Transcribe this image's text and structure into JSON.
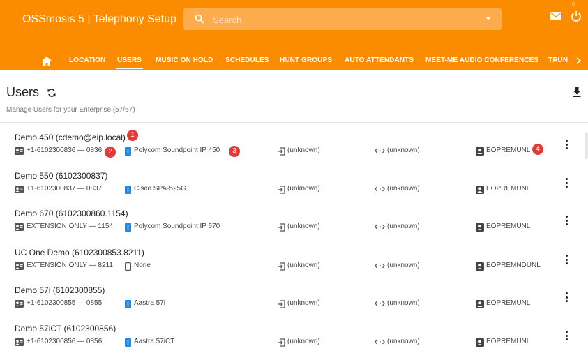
{
  "app": {
    "title": "OSSmosis 5 | Telephony Setup",
    "search_placeholder": "Search",
    "notification_count": "0"
  },
  "nav": {
    "tabs": [
      {
        "label": "LOCATION"
      },
      {
        "label": "USERS",
        "active": true
      },
      {
        "label": "MUSIC ON HOLD"
      },
      {
        "label": "SCHEDULES"
      },
      {
        "label": "HUNT GROUPS"
      },
      {
        "label": "AUTO ATTENDANTS"
      },
      {
        "label": "MEET-ME AUDIO CONFERENCES"
      },
      {
        "label": "TRUNKS"
      }
    ]
  },
  "page": {
    "title": "Users",
    "subtitle": "Manage Users for your Enterprise (57/57)"
  },
  "users": [
    {
      "name": "Demo 450 (cdemo@eip.local)",
      "extension": "+1-6102300836 — 0836",
      "device": "Polycom Soundpoint IP 450",
      "incoming": "(unknown)",
      "outgoing": "(unknown)",
      "package": "EOPREMUNL"
    },
    {
      "name": "Demo 550 (6102300837)",
      "extension": "+1-6102300837 — 0837",
      "device": "Cisco SPA-525G",
      "incoming": "(unknown)",
      "outgoing": "(unknown)",
      "package": "EOPREMUNL"
    },
    {
      "name": "Demo 670 (6102300860.1154)",
      "extension": "EXTENSION ONLY — 1154",
      "device": "Polycom Soundpoint IP 670",
      "incoming": "(unknown)",
      "outgoing": "(unknown)",
      "package": "EOPREMUNL"
    },
    {
      "name": "UC One Demo (6102300853.8211)",
      "extension": "EXTENSION ONLY — 8211",
      "device": "None",
      "incoming": "(unknown)",
      "outgoing": "(unknown)",
      "package": "EOPREMNDUNL"
    },
    {
      "name": "Demo 57i (6102300855)",
      "extension": "+1-6102300855 — 0855",
      "device": "Aastra 57i",
      "incoming": "(unknown)",
      "outgoing": "(unknown)",
      "package": "EOPREMUNL"
    },
    {
      "name": "Demo 57iCT (6102300856)",
      "extension": "+1-6102300856 — 0856",
      "device": "Aastra 57iCT",
      "incoming": "(unknown)",
      "outgoing": "(unknown)",
      "package": "EOPREMUNL"
    }
  ],
  "callouts": [
    "1",
    "2",
    "3",
    "4"
  ],
  "colors": {
    "primary": "#fb8c00",
    "device_icon": "#1e88e5",
    "callout": "#e53935"
  },
  "icons": {
    "home": "home-icon",
    "search": "search-icon",
    "mail": "mail-icon",
    "power": "power-icon",
    "sync": "sync-icon",
    "download": "download-icon",
    "next": "chevron-right-icon",
    "extension": "contact-card-icon",
    "device": "phone-device-icon",
    "incoming": "login-icon",
    "outgoing": "code-arrows-icon",
    "package": "badge-icon",
    "menu": "more-vert-icon"
  }
}
